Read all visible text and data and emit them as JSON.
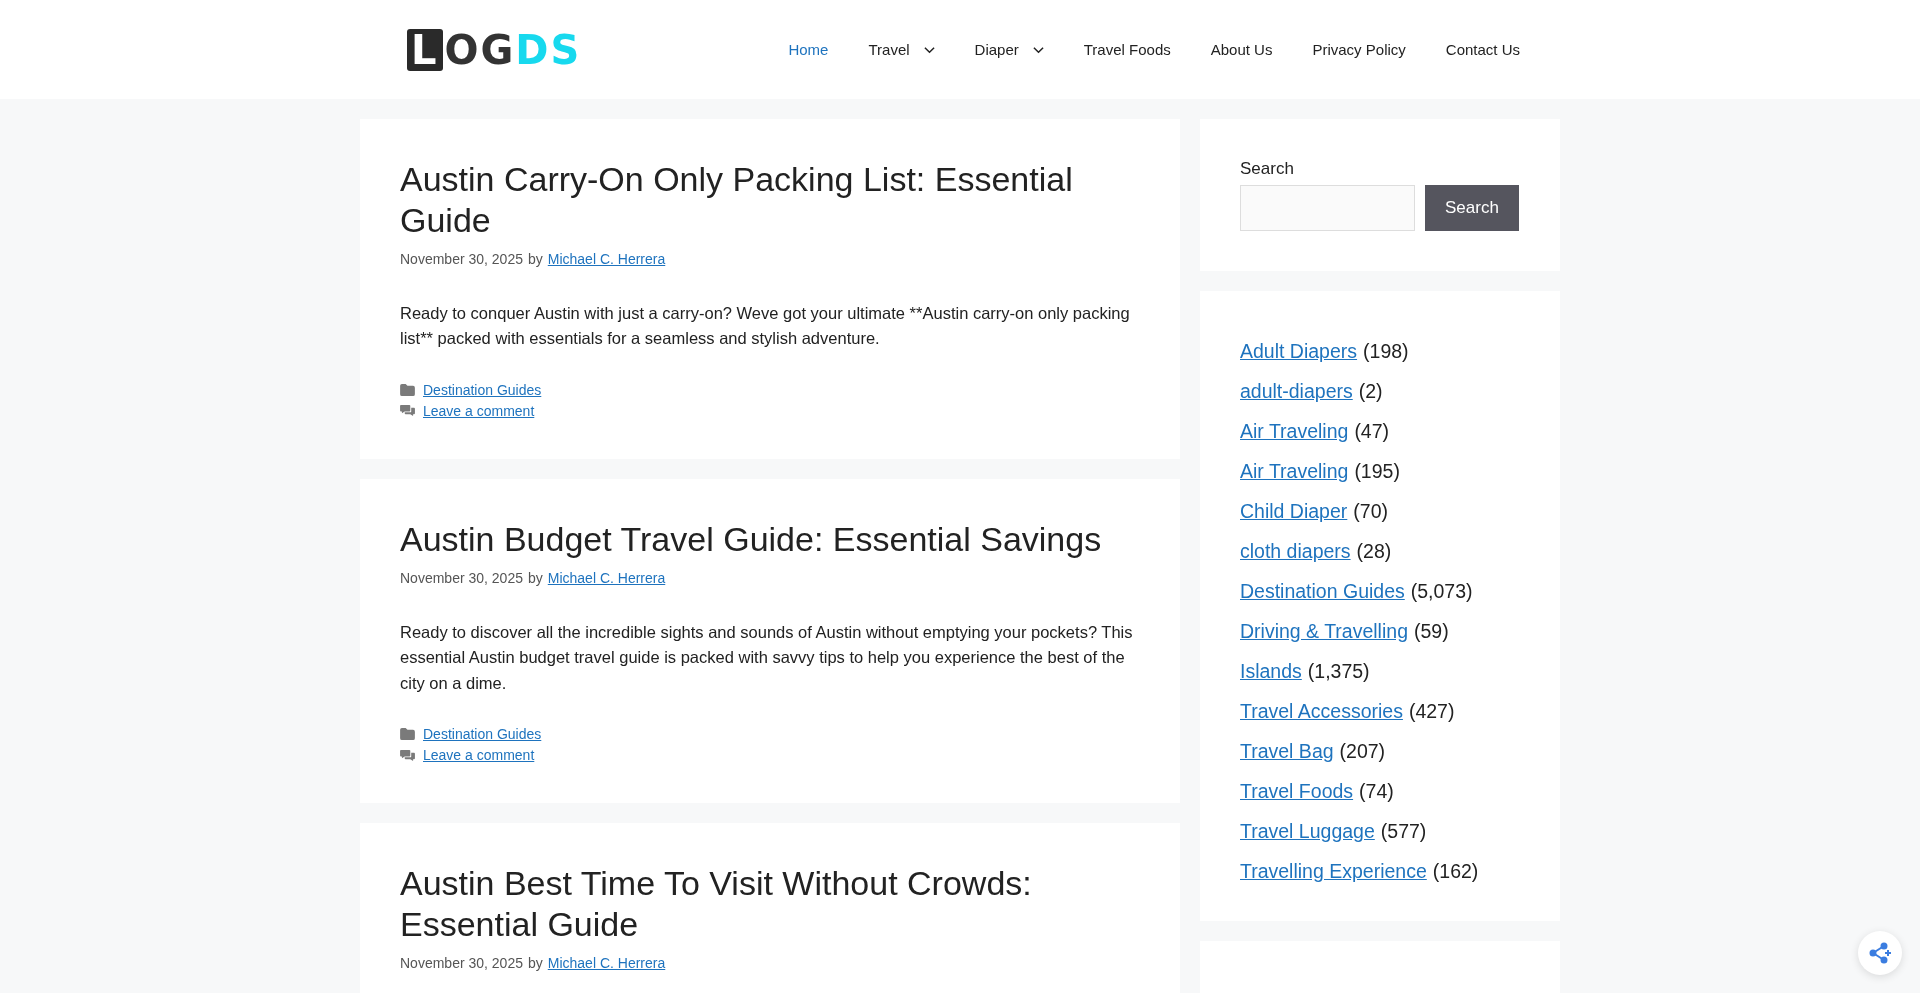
{
  "logo": {
    "boxed": "L",
    "dark": "OG",
    "accent": "DS"
  },
  "nav": [
    {
      "label": "Home",
      "selected": true,
      "dropdown": false
    },
    {
      "label": "Travel",
      "selected": false,
      "dropdown": true
    },
    {
      "label": "Diaper",
      "selected": false,
      "dropdown": true
    },
    {
      "label": "Travel Foods",
      "selected": false,
      "dropdown": false
    },
    {
      "label": "About Us",
      "selected": false,
      "dropdown": false
    },
    {
      "label": "Privacy Policy",
      "selected": false,
      "dropdown": false
    },
    {
      "label": "Contact Us",
      "selected": false,
      "dropdown": false
    }
  ],
  "posts": [
    {
      "title": "Austin Carry-On Only Packing List: Essential Guide",
      "date": "November 30, 2025",
      "by": "by",
      "author": "Michael C. Herrera",
      "excerpt": "Ready to conquer Austin with just a carry-on? Weve got your ultimate **Austin carry-on only packing list** packed with essentials for a seamless and stylish adventure.",
      "category": "Destination Guides",
      "comment": "Leave a comment"
    },
    {
      "title": "Austin Budget Travel Guide: Essential Savings",
      "date": "November 30, 2025",
      "by": "by",
      "author": "Michael C. Herrera",
      "excerpt": "Ready to discover all the incredible sights and sounds of Austin without emptying your pockets? This essential Austin budget travel guide is packed with savvy tips to help you experience the best of the city on a dime.",
      "category": "Destination Guides",
      "comment": "Leave a comment"
    },
    {
      "title": "Austin Best Time To Visit Without Crowds: Essential Guide",
      "date": "November 30, 2025",
      "by": "by",
      "author": "Michael C. Herrera"
    }
  ],
  "search": {
    "label": "Search",
    "button": "Search"
  },
  "categories": [
    {
      "name": "Adult Diapers",
      "count": "(198)"
    },
    {
      "name": "adult-diapers",
      "count": "(2)"
    },
    {
      "name": "Air Traveling",
      "count": "(47)"
    },
    {
      "name": "Air Traveling",
      "count": "(195)"
    },
    {
      "name": "Child Diaper",
      "count": "(70)"
    },
    {
      "name": "cloth diapers",
      "count": "(28)"
    },
    {
      "name": "Destination Guides",
      "count": "(5,073)"
    },
    {
      "name": "Driving & Travelling",
      "count": "(59)"
    },
    {
      "name": "Islands",
      "count": "(1,375)"
    },
    {
      "name": "Travel Accessories",
      "count": "(427)"
    },
    {
      "name": "Travel Bag",
      "count": "(207)"
    },
    {
      "name": "Travel Foods",
      "count": "(74)"
    },
    {
      "name": "Travel Luggage",
      "count": "(577)"
    },
    {
      "name": "Travelling Experience",
      "count": "(162)"
    }
  ]
}
